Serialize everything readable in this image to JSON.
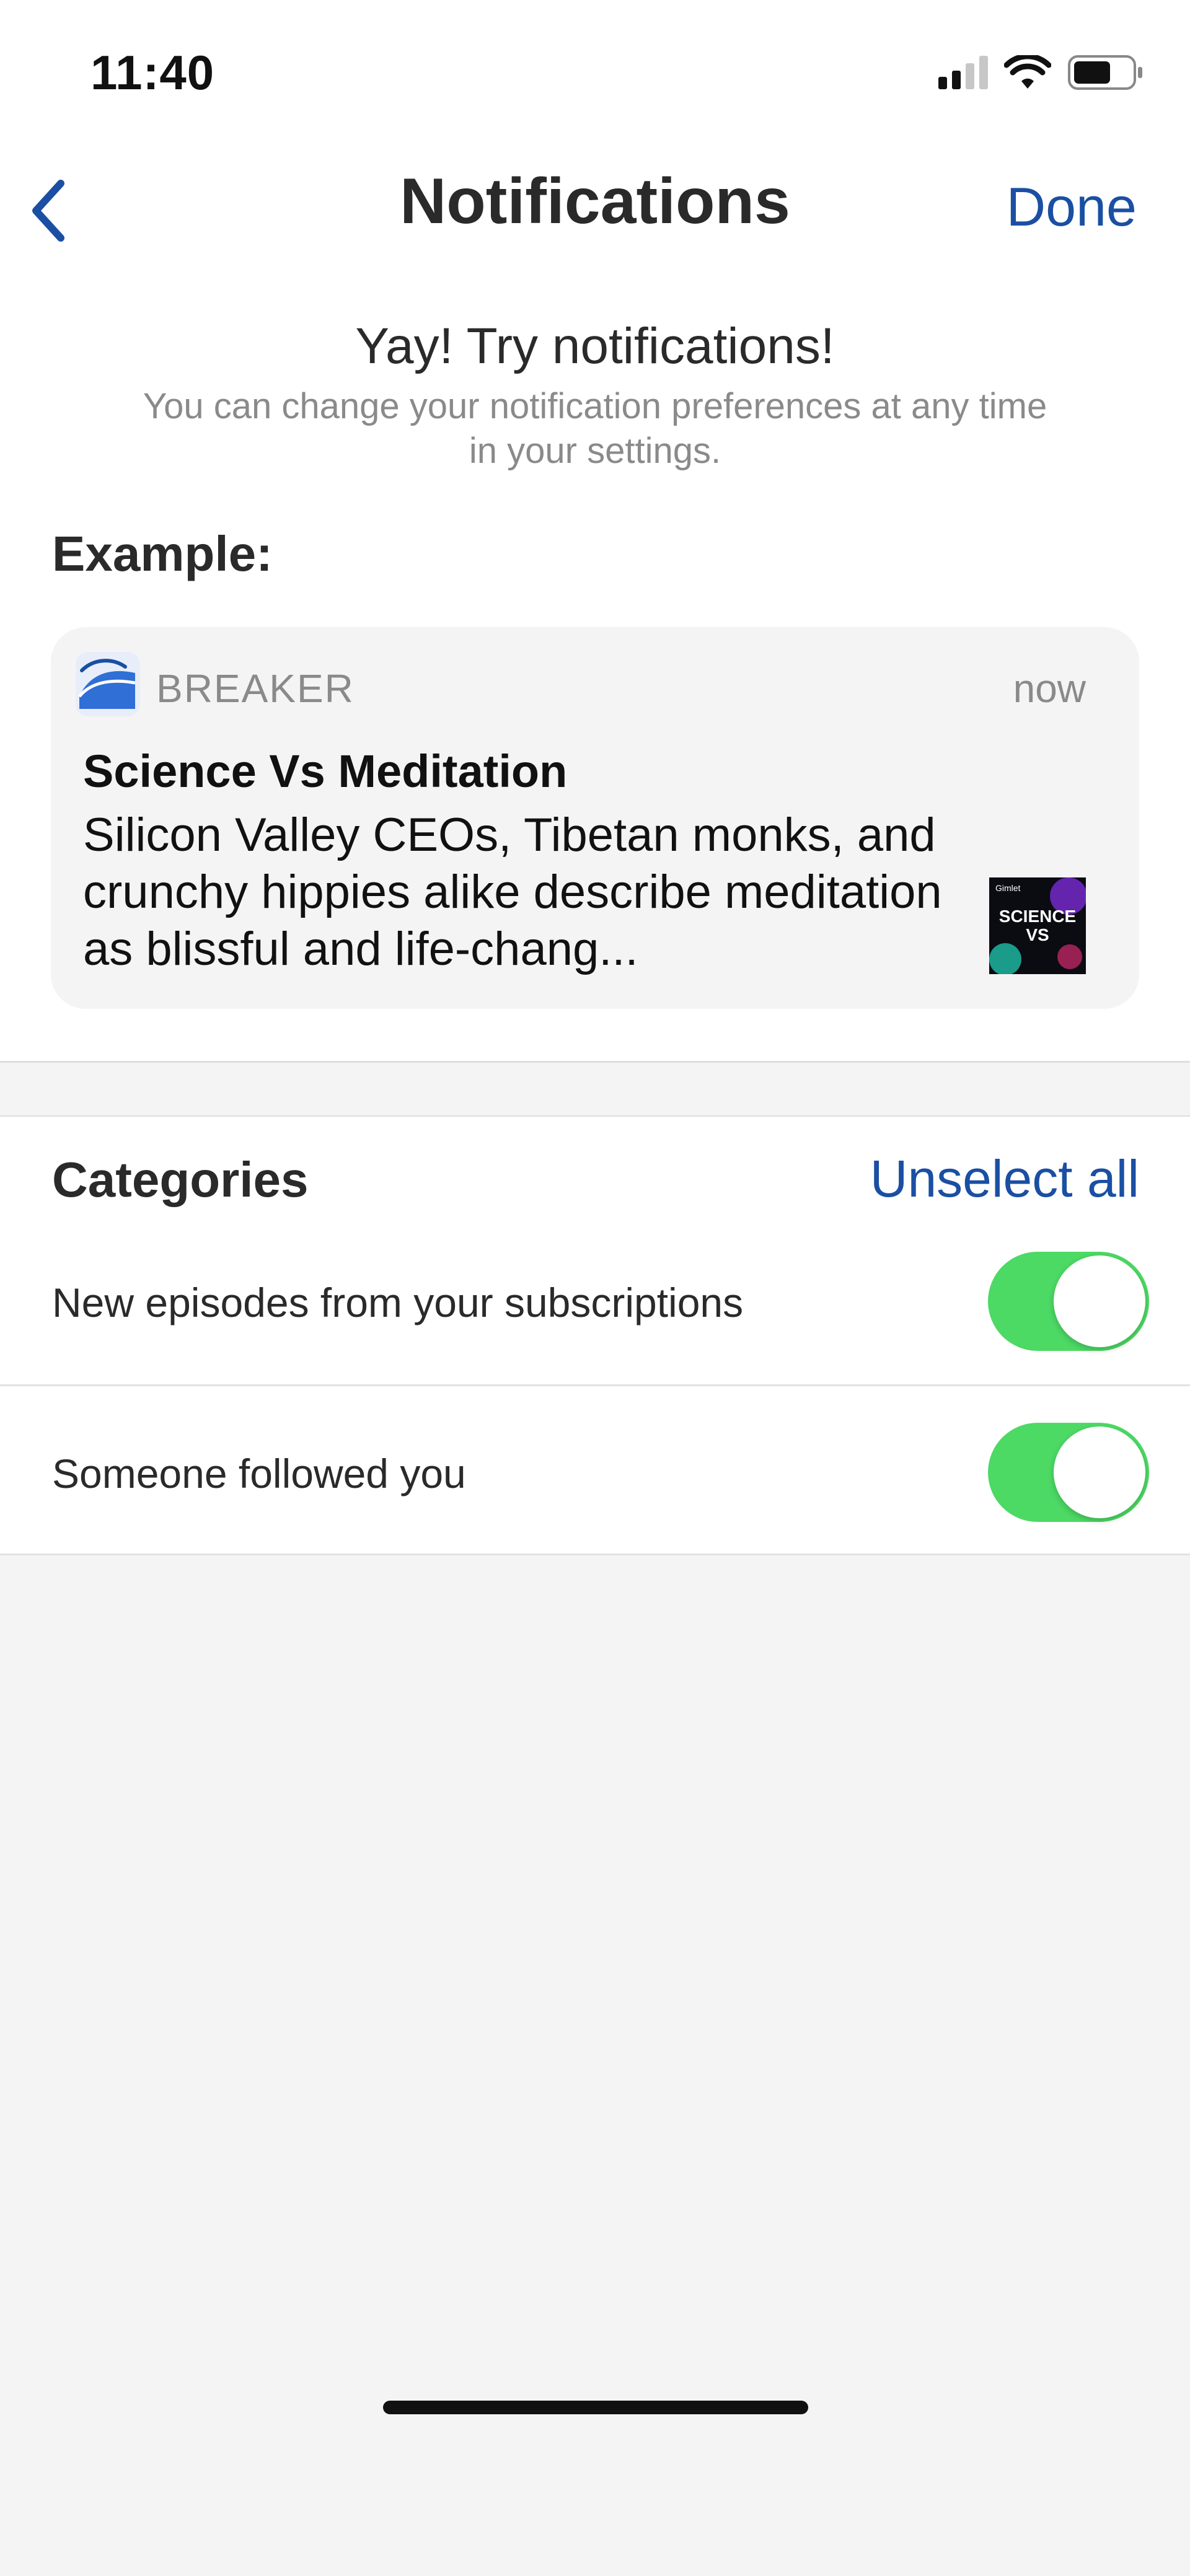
{
  "status_bar": {
    "time": "11:40",
    "icons": [
      "signal-icon",
      "wifi-icon",
      "battery-icon"
    ]
  },
  "nav": {
    "back_icon": "chevron-left-icon",
    "title": "Notifications",
    "done_label": "Done"
  },
  "intro": {
    "title": "Yay! Try notifications!",
    "subtitle": "You can change your notification preferences at any time in your settings."
  },
  "example": {
    "label": "Example:",
    "notification": {
      "app_icon": "breaker-app-icon",
      "app_name": "BREAKER",
      "time": "now",
      "title": "Science Vs Meditation",
      "body": "Silicon Valley CEOs, Tibetan monks, and crunchy hippies alike describe meditation as blissful and life-chang...",
      "thumbnail": {
        "brand": "Gimlet",
        "line1": "SCIENCE",
        "line2": "VS"
      }
    }
  },
  "categories": {
    "header": "Categories",
    "unselect_all_label": "Unselect all",
    "items": [
      {
        "label": "New episodes from your subscriptions",
        "enabled": true
      },
      {
        "label": "Someone followed you",
        "enabled": true
      }
    ]
  },
  "colors": {
    "accent": "#1a4fa3",
    "toggle_on": "#4cd964",
    "background": "#f4f4f4"
  }
}
